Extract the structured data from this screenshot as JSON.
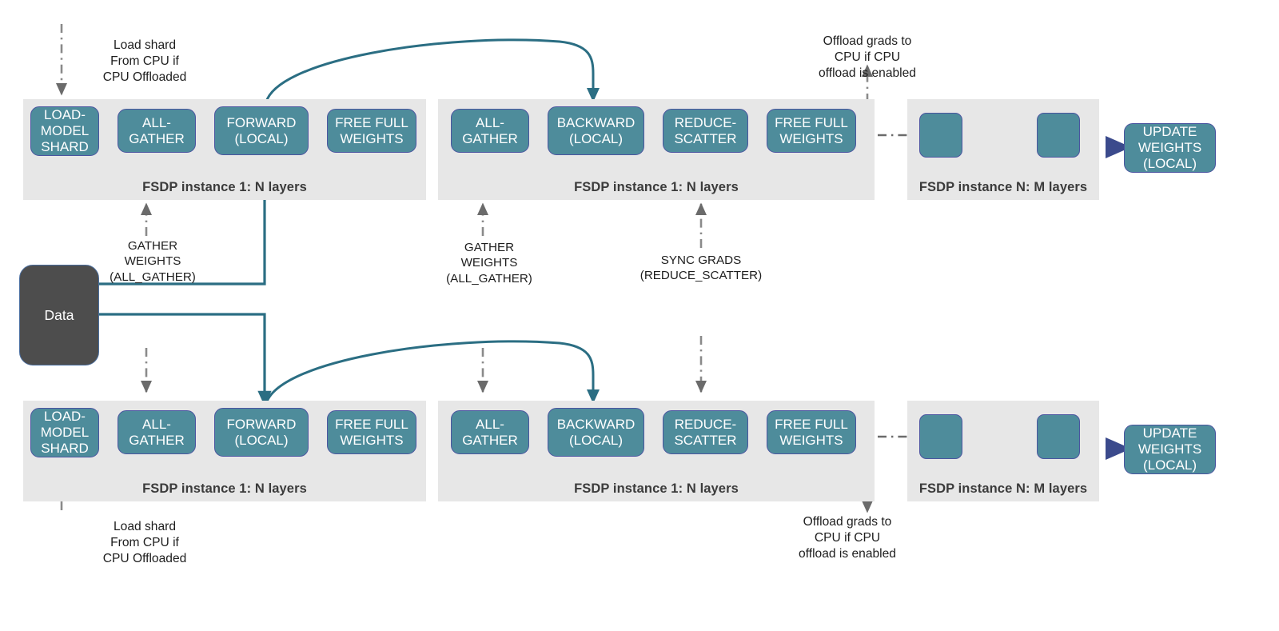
{
  "diagram": {
    "title": "FSDP training flow",
    "colors": {
      "node_fill": "#4e8c9b",
      "node_border": "#4b55a0",
      "panel_fill": "#e7e7e7",
      "data_fill": "#4d4d4d",
      "solid_arrow": "#3b4a8c",
      "teal_line": "#2b6e83",
      "dash_arrow": "#6b6b6b",
      "text_dark": "#1d1d1d"
    },
    "data_source": {
      "label": "Data"
    },
    "rows": [
      {
        "id": "row-top",
        "panels": [
          {
            "id": "top-fsdp1-forward",
            "label": "FSDP instance 1: N layers",
            "nodes": [
              {
                "id": "load-model-shard",
                "lines": [
                  "LOAD-",
                  "MODEL",
                  "SHARD"
                ]
              },
              {
                "id": "all-gather",
                "lines": [
                  "ALL-",
                  "GATHER"
                ]
              },
              {
                "id": "forward-local",
                "lines": [
                  "FORWARD",
                  "(LOCAL)"
                ]
              },
              {
                "id": "free-full-weights",
                "lines": [
                  "FREE FULL",
                  "WEIGHTS"
                ]
              }
            ]
          },
          {
            "id": "top-fsdp1-backward",
            "label": "FSDP instance 1: N layers",
            "nodes": [
              {
                "id": "all-gather-2",
                "lines": [
                  "ALL-",
                  "GATHER"
                ]
              },
              {
                "id": "backward-local",
                "lines": [
                  "BACKWARD",
                  "(LOCAL)"
                ]
              },
              {
                "id": "reduce-scatter",
                "lines": [
                  "REDUCE-",
                  "SCATTER"
                ]
              },
              {
                "id": "free-full-weights-2",
                "lines": [
                  "FREE FULL",
                  "WEIGHTS"
                ]
              }
            ]
          },
          {
            "id": "top-fsdp-n",
            "label": "FSDP instance N: M layers",
            "nodes": [
              {
                "id": "fsdpn-block-a",
                "lines": [
                  ""
                ]
              },
              {
                "id": "fsdpn-block-b",
                "lines": [
                  ""
                ]
              }
            ]
          }
        ],
        "update_weights": {
          "id": "update-weights",
          "lines": [
            "UPDATE",
            "WEIGHTS",
            "(LOCAL)"
          ]
        },
        "notes": {
          "load_shard": "Load shard\nFrom CPU if\nCPU Offloaded",
          "offload_grads": "Offload grads to\nCPU if CPU\noffload is enabled"
        }
      },
      {
        "id": "row-bottom",
        "panels": [
          {
            "id": "bottom-fsdp1-forward",
            "label": "FSDP instance 1: N layers",
            "nodes": [
              {
                "id": "load-model-shard-b",
                "lines": [
                  "LOAD-",
                  "MODEL",
                  "SHARD"
                ]
              },
              {
                "id": "all-gather-b",
                "lines": [
                  "ALL-",
                  "GATHER"
                ]
              },
              {
                "id": "forward-local-b",
                "lines": [
                  "FORWARD",
                  "(LOCAL)"
                ]
              },
              {
                "id": "free-full-weights-b",
                "lines": [
                  "FREE FULL",
                  "WEIGHTS"
                ]
              }
            ]
          },
          {
            "id": "bottom-fsdp1-backward",
            "label": "FSDP instance 1: N layers",
            "nodes": [
              {
                "id": "all-gather-2b",
                "lines": [
                  "ALL-",
                  "GATHER"
                ]
              },
              {
                "id": "backward-local-b",
                "lines": [
                  "BACKWARD",
                  "(LOCAL)"
                ]
              },
              {
                "id": "reduce-scatter-b",
                "lines": [
                  "REDUCE-",
                  "SCATTER"
                ]
              },
              {
                "id": "free-full-weights-2b",
                "lines": [
                  "FREE FULL",
                  "WEIGHTS"
                ]
              }
            ]
          },
          {
            "id": "bottom-fsdp-n",
            "label": "FSDP instance N: M layers",
            "nodes": [
              {
                "id": "fsdpn-block-ab",
                "lines": [
                  ""
                ]
              },
              {
                "id": "fsdpn-block-bb",
                "lines": [
                  ""
                ]
              }
            ]
          }
        ],
        "update_weights": {
          "id": "update-weights-b",
          "lines": [
            "UPDATE",
            "WEIGHTS",
            "(LOCAL)"
          ]
        },
        "notes": {
          "load_shard": "Load shard\nFrom CPU if\nCPU Offloaded",
          "offload_grads": "Offload grads to\nCPU if CPU\noffload is enabled"
        }
      }
    ],
    "sync_labels": {
      "gather_weights_left": "GATHER\nWEIGHTS\n(ALL_GATHER)",
      "gather_weights_mid": "GATHER\nWEIGHTS\n(ALL_GATHER)",
      "sync_grads": "SYNC GRADS\n(REDUCE_SCATTER)"
    }
  }
}
